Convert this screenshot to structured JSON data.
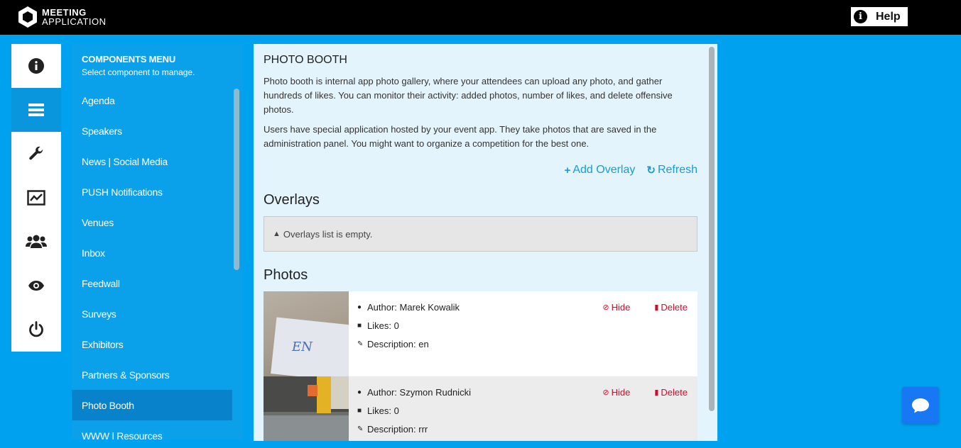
{
  "app": {
    "logo_line1": "MEETING",
    "logo_line2": "APPLICATION",
    "help_label": "Help"
  },
  "iconbar": {
    "items": [
      {
        "icon": "info-icon",
        "active": false
      },
      {
        "icon": "menu-bars-icon",
        "active": true
      },
      {
        "icon": "wrench-icon",
        "active": false
      },
      {
        "icon": "chart-icon",
        "active": false
      },
      {
        "icon": "users-icon",
        "active": false
      },
      {
        "icon": "eye-icon",
        "active": false
      },
      {
        "icon": "power-icon",
        "active": false
      }
    ]
  },
  "menu": {
    "title": "COMPONENTS MENU",
    "subtitle": "Select component to manage.",
    "items": [
      {
        "label": "Agenda",
        "active": false
      },
      {
        "label": "Speakers",
        "active": false
      },
      {
        "label": "News | Social Media",
        "active": false
      },
      {
        "label": "PUSH Notifications",
        "active": false
      },
      {
        "label": "Venues",
        "active": false
      },
      {
        "label": "Inbox",
        "active": false
      },
      {
        "label": "Feedwall",
        "active": false
      },
      {
        "label": "Surveys",
        "active": false
      },
      {
        "label": "Exhibitors",
        "active": false
      },
      {
        "label": "Partners & Sponsors",
        "active": false
      },
      {
        "label": "Photo Booth",
        "active": true
      },
      {
        "label": "WWW | Resources",
        "active": false
      }
    ]
  },
  "main": {
    "title": "PHOTO BOOTH",
    "para1": "Photo booth is internal app photo gallery, where your attendees can upload any photo, and gather hundreds of likes. You can monitor their activity: added photos, number of likes, and delete offensive photos.",
    "para2": "Users have special application hosted by your event app. They take photos that are saved in the administration panel. You might want to organize a competition for the best one.",
    "add_overlay": "Add Overlay",
    "refresh": "Refresh",
    "overlays_title": "Overlays",
    "overlays_empty": "Overlays list is empty.",
    "photos_title": "Photos",
    "photos": [
      {
        "author": "Author: Marek Kowalik",
        "likes": "Likes: 0",
        "description": "Description: en",
        "hide": "Hide",
        "delete": "Delete"
      },
      {
        "author": "Author: Szymon Rudnicki",
        "likes": "Likes: 0",
        "description": "Description: rrr",
        "hide": "Hide",
        "delete": "Delete"
      }
    ]
  },
  "colors": {
    "background": "#00a2f0",
    "topbar": "#000000",
    "menu": "#0aa0ea",
    "menu_active": "#0782cb",
    "main_bg": "#e4f4fd",
    "link": "#1a9ad6",
    "danger": "#c8102e",
    "chat": "#1877f2"
  }
}
